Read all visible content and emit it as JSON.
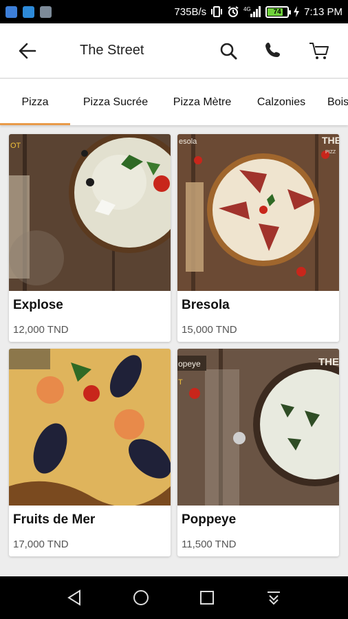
{
  "status_bar": {
    "speed": "735B/s",
    "battery_level": "74",
    "time": "7:13 PM",
    "icons": [
      "notification-app-icon",
      "usb-icon",
      "image-icon",
      "vibrate-icon",
      "alarm-icon",
      "signal-icon",
      "battery-icon",
      "charging-icon"
    ]
  },
  "header": {
    "title": "The Street",
    "icons": {
      "back": "arrow-left",
      "search": "magnifier",
      "call": "phone",
      "cart": "shopping-cart"
    }
  },
  "tabs": [
    {
      "label": "Pizza",
      "active": true
    },
    {
      "label": "Pizza Sucrée",
      "active": false
    },
    {
      "label": "Pizza Mètre",
      "active": false
    },
    {
      "label": "Calzonies",
      "active": false
    },
    {
      "label": "Bois",
      "active": false
    }
  ],
  "products": [
    {
      "name": "Explose",
      "price": "12,000 TND",
      "photo": "white pizza with greens and tomatoes"
    },
    {
      "name": "Bresola",
      "price": "15,000 TND",
      "photo": "pizza with bresaola slices"
    },
    {
      "name": "Fruits de Mer",
      "price": "17,000 TND",
      "photo": "seafood pizza with mussels and shrimp"
    },
    {
      "name": "Poppeye",
      "price": "11,500 TND",
      "photo": "spinach white pizza"
    }
  ],
  "photo_overlays": {
    "c0_tag": "OT",
    "c1_tag": "esola",
    "c1_brand": "THE",
    "c1_brand_sub": "PIZZ",
    "c3_tag": "opeye",
    "c3_brand": "THE",
    "c3_corner": "T"
  },
  "colors": {
    "accent": "#e99a48",
    "status_bar": "#000000",
    "app_bar": "#ffffff",
    "background": "#ededed",
    "battery_fill": "#6fd13b"
  },
  "nav_bar": {
    "icons": [
      "back-triangle-icon",
      "home-circle-icon",
      "recents-square-icon",
      "notification-shade-icon"
    ]
  }
}
